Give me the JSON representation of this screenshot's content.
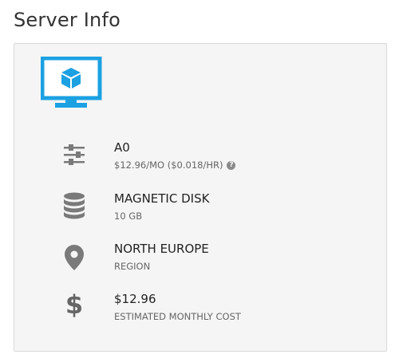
{
  "page": {
    "title": "Server Info"
  },
  "server": {
    "icon": "monitor-cube-icon",
    "accent_color": "#1ba1e2",
    "items": [
      {
        "icon": "sliders-icon",
        "title": "A0",
        "subtitle": "$12.96/MO ($0.018/HR)",
        "help_icon": "question-circle-icon",
        "help_label": "?"
      },
      {
        "icon": "database-icon",
        "title": "MAGNETIC DISK",
        "subtitle": "10 GB"
      },
      {
        "icon": "map-pin-icon",
        "title": "NORTH EUROPE",
        "subtitle": "REGION"
      },
      {
        "icon": "dollar-icon",
        "icon_glyph": "$",
        "title": "$12.96",
        "subtitle": "ESTIMATED MONTHLY COST"
      }
    ]
  }
}
